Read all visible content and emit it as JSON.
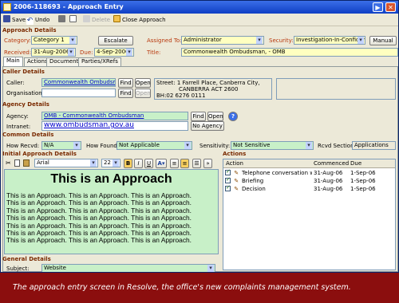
{
  "window": {
    "title": "2006-118693 - Approach Entry",
    "controls": [
      "▶",
      "✕"
    ]
  },
  "toolbar": {
    "save": "Save",
    "undo": "Undo",
    "delete": "Delete",
    "close": "Close Approach"
  },
  "approach": {
    "section": "Approach Details",
    "category_label": "Category:",
    "category": "Category 1",
    "escalate": "Escalate",
    "assigned_label": "Assigned To:",
    "assigned": "Administrator",
    "security_label": "Security:",
    "security": "Investigation-In-Confidence",
    "manual": "Manual",
    "received_label": "Received:",
    "received": "31-Aug-2006",
    "due_label": "Due:",
    "due": "4-Sep-2006",
    "title_label": "Title:",
    "title": "Commonwealth Ombudsman,  - OMB"
  },
  "tabs": [
    "Main",
    "Actions",
    "Documents",
    "Parties/XRefs"
  ],
  "caller": {
    "section": "Caller Details",
    "caller_label": "Caller:",
    "caller": "Commonwealth Ombudsman,",
    "org_label": "Organisation:",
    "find": "Find",
    "open": "Open",
    "address": [
      "Street: 1 Farrell Place, Canberra City,",
      "CANBERRA ACT 2600",
      "BH:02 6276 0111"
    ]
  },
  "agency": {
    "section": "Agency Details",
    "agency_label": "Agency:",
    "agency": "OMB - Commonwealth Ombudsman",
    "intranet_label": "Intranet:",
    "intranet": "www.ombudsman.gov.au",
    "find": "Find",
    "open": "Open",
    "no_agency": "No Agency",
    "help": "?"
  },
  "common": {
    "section": "Common Details",
    "recvd_label": "How Recvd:",
    "recvd": "N/A",
    "found_label": "How Found:",
    "found": "Not Applicable",
    "sens_label": "Sensitivity:",
    "sens": "Not Sensitive",
    "rsection_label": "Rcvd Section:",
    "rsection": "Applications"
  },
  "initial": {
    "section": "Initial Approach Details",
    "font": "Arial",
    "size": "22",
    "heading": "This is an Approach",
    "lines": [
      "This is an Approach. This is an Approach. This is an Approach.",
      "This is an Approach. This is an Approach. This is an Approach.",
      "This is an Approach. This is an Approach. This is an Approach.",
      "This is an Approach. This is an Approach. This is an Approach.",
      "This is an Approach. This is an Approach. This is an Approach.",
      "This is an Approach. This is an Approach. This is an Approach.",
      "This is an Approach. This is an Approach. This is an Approach."
    ]
  },
  "general": {
    "section": "General Details",
    "subject_label": "Subject:",
    "subject": "Website"
  },
  "actions": {
    "section": "Actions",
    "columns": [
      "Action",
      "Commenced",
      "Due"
    ],
    "rows": [
      {
        "action": "Telephone conversation w...",
        "commenced": "31-Aug-06",
        "due": "1-Sep-06"
      },
      {
        "action": "Briefing",
        "commenced": "31-Aug-06",
        "due": "1-Sep-06"
      },
      {
        "action": "Decision",
        "commenced": "31-Aug-06",
        "due": "1-Sep-06"
      }
    ]
  },
  "caption": "The approach entry screen in Resolve, the office's new complaints management system."
}
